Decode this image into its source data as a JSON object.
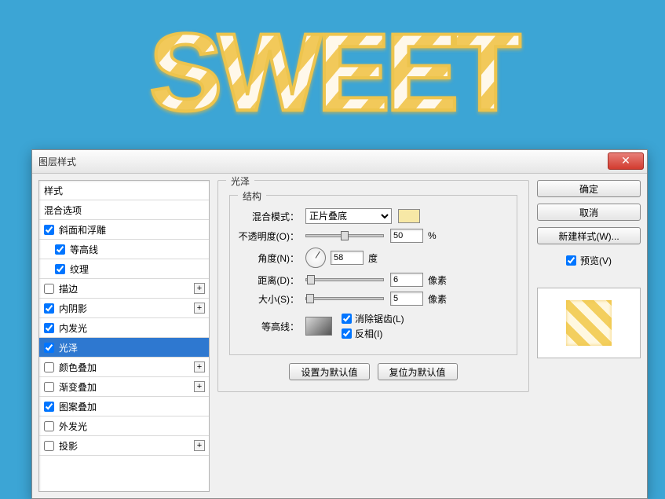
{
  "dialog": {
    "title": "图层样式"
  },
  "styleList": {
    "header_styles": "样式",
    "header_blend": "混合选项",
    "bevel": "斜面和浮雕",
    "contour": "等高线",
    "texture": "纹理",
    "stroke": "描边",
    "innerShadow": "内阴影",
    "innerGlow": "内发光",
    "satin": "光泽",
    "colorOverlay": "颜色叠加",
    "gradientOverlay": "渐变叠加",
    "patternOverlay": "图案叠加",
    "outerGlow": "外发光",
    "dropShadow": "投影"
  },
  "settings": {
    "panelTitle": "光泽",
    "structTitle": "结构",
    "blendMode_label": "混合模式：",
    "blendMode_value": "正片叠底",
    "opacity_label": "不透明度(O)：",
    "opacity_value": "50",
    "opacity_unit": "%",
    "angle_label": "角度(N)：",
    "angle_value": "58",
    "angle_unit": "度",
    "distance_label": "距离(D)：",
    "distance_value": "6",
    "distance_unit": "像素",
    "size_label": "大小(S)：",
    "size_value": "5",
    "size_unit": "像素",
    "contour_label": "等高线：",
    "antialias_label": "消除锯齿(L)",
    "invert_label": "反相(I)",
    "setDefault": "设置为默认值",
    "resetDefault": "复位为默认值"
  },
  "buttons": {
    "ok": "确定",
    "cancel": "取消",
    "newStyle": "新建样式(W)...",
    "preview": "预览(V)"
  }
}
